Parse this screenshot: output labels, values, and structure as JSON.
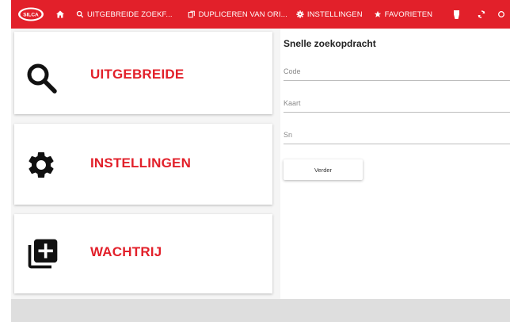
{
  "topbar": {
    "logo_text": "SILCA",
    "nav": [
      {
        "label": "UITGEBREIDE ZOEKF...",
        "icon": "search-icon"
      },
      {
        "label": "DUPLICEREN VAN ORI...",
        "icon": "copy-icon"
      },
      {
        "label": "INSTELLINGEN",
        "icon": "gear-icon"
      },
      {
        "label": "FAVORIETEN",
        "icon": "star-icon"
      }
    ],
    "icons": [
      "home-icon",
      "key-icon",
      "sync-icon"
    ],
    "bg_color": "#e2202a"
  },
  "cards": [
    {
      "label": "UITGEBREIDE",
      "icon": "search-icon"
    },
    {
      "label": "INSTELLINGEN",
      "icon": "gear-icon"
    },
    {
      "label": "WACHTRIJ",
      "icon": "queue-add-icon"
    }
  ],
  "search_panel": {
    "title": "Snelle zoekopdracht",
    "fields": [
      {
        "placeholder": "Code",
        "value": ""
      },
      {
        "placeholder": "Kaart",
        "value": ""
      },
      {
        "placeholder": "Sn",
        "value": ""
      }
    ],
    "submit_label": "Verder"
  },
  "colors": {
    "accent": "#e2202a",
    "footer": "#dedede"
  }
}
